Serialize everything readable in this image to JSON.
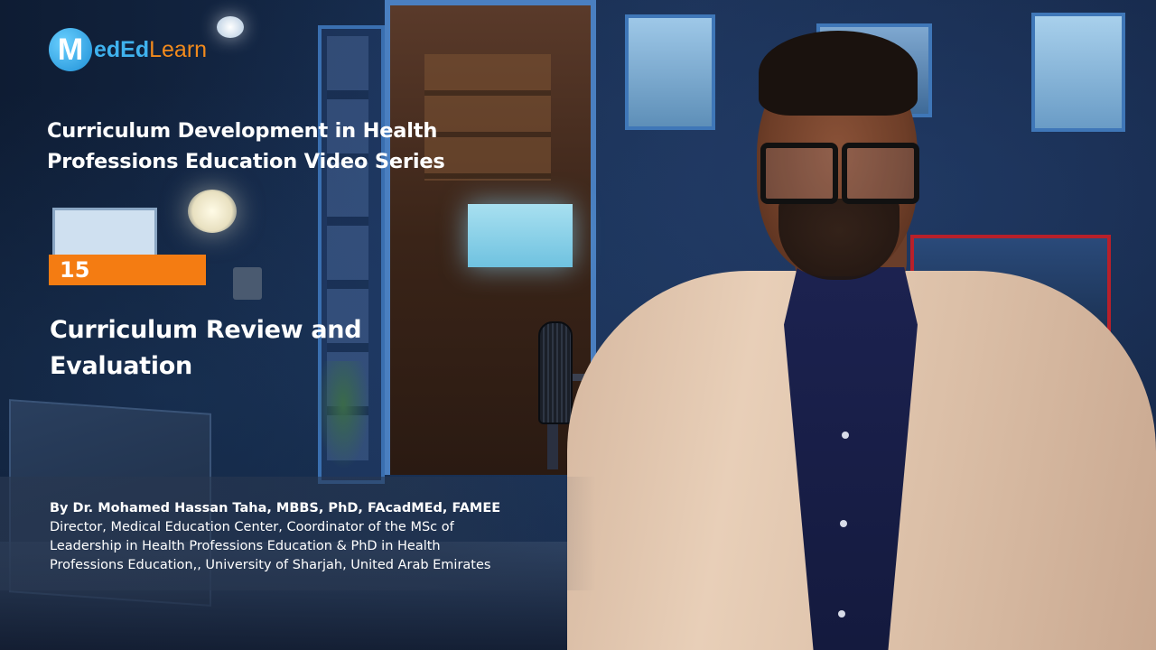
{
  "brand": {
    "logo_letter": "M",
    "logo_part_a": "edEd",
    "logo_part_b": "Learn",
    "colors": {
      "blue": "#3fb2ee",
      "orange": "#f28a1c",
      "episode_bar": "#f47c12"
    }
  },
  "series": {
    "title_line1": "Curriculum Development in Health",
    "title_line2": "Professions Education Video Series"
  },
  "episode": {
    "number": "15",
    "title_line1": "Curriculum Review and",
    "title_line2": "Evaluation"
  },
  "presenter": {
    "byline": "By Dr. Mohamed Hassan Taha, MBBS, PhD, FAcadMEd, FAMEE",
    "affiliation_line1": "Director, Medical Education Center, Coordinator of the MSc of",
    "affiliation_line2": "Leadership in Health Professions Education & PhD in Health",
    "affiliation_line3": "Professions Education,, University of Sharjah, United Arab Emirates"
  }
}
